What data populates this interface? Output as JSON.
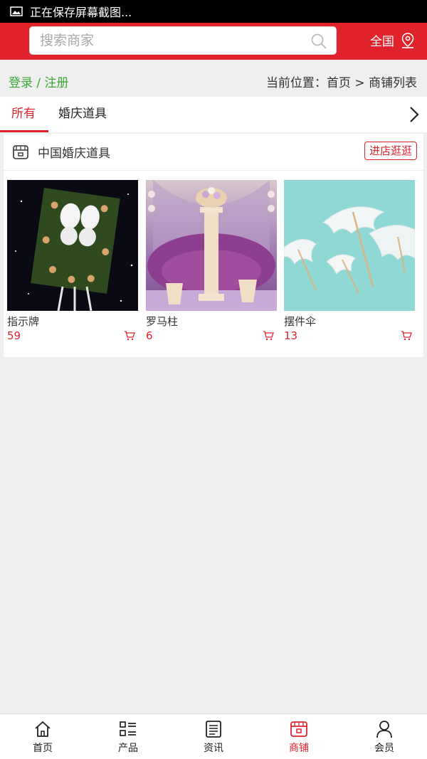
{
  "status_bar": {
    "text": "正在保存屏幕截图..."
  },
  "header": {
    "search_placeholder": "搜索商家",
    "region_label": "全国"
  },
  "crumb": {
    "login": "登录 / 注册",
    "location": "当前位置：首页 > 商铺列表"
  },
  "tabs": [
    {
      "label": "所有",
      "active": true
    },
    {
      "label": "婚庆道具",
      "active": false
    }
  ],
  "shop": {
    "name": "中国婚庆道具",
    "enter_label": "进店逛逛",
    "products": [
      {
        "name": "指示牌",
        "count": "59"
      },
      {
        "name": "罗马柱",
        "count": "6"
      },
      {
        "name": "摆件伞",
        "count": "13"
      }
    ]
  },
  "bottom_nav": [
    {
      "label": "首页",
      "icon": "home-icon"
    },
    {
      "label": "产品",
      "icon": "list-icon"
    },
    {
      "label": "资讯",
      "icon": "news-icon"
    },
    {
      "label": "商铺",
      "icon": "store-icon",
      "active": true
    },
    {
      "label": "会员",
      "icon": "user-icon"
    }
  ],
  "colors": {
    "brand": "#e0222d",
    "login": "#3aa635",
    "background": "#efefef"
  }
}
